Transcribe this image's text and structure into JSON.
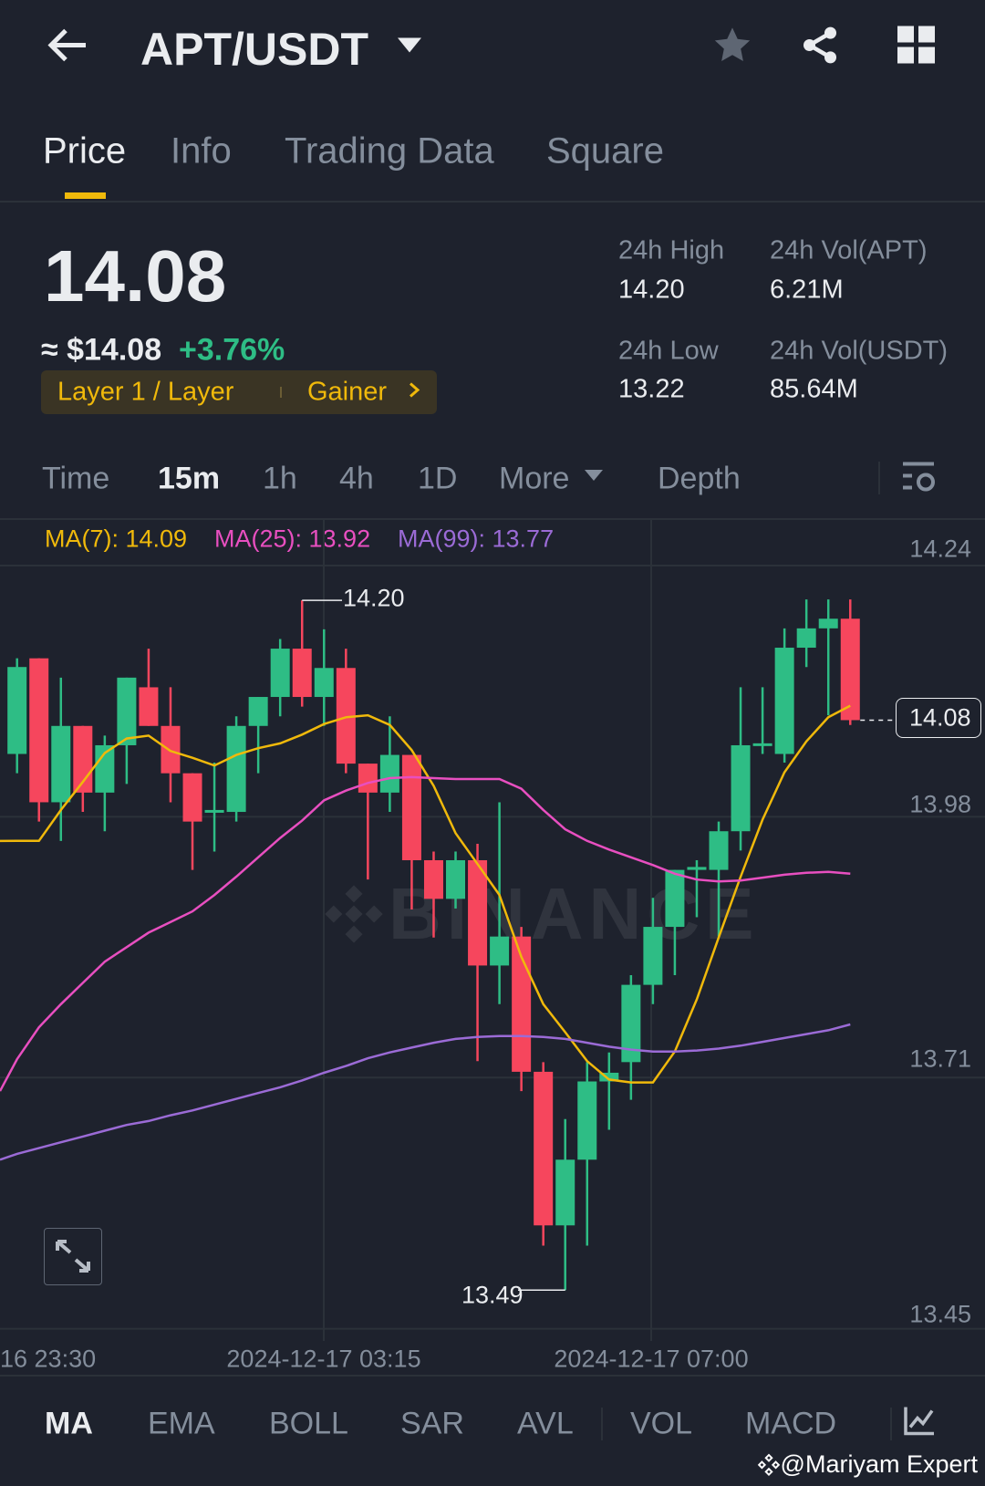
{
  "header": {
    "title": "APT/USDT",
    "icons": [
      "back-arrow-icon",
      "caret-down-icon",
      "star-icon",
      "share-icon",
      "grid-icon"
    ]
  },
  "tabs": [
    {
      "label": "Price",
      "active": true
    },
    {
      "label": "Info"
    },
    {
      "label": "Trading Data"
    },
    {
      "label": "Square"
    }
  ],
  "ticker": {
    "last_price": "14.08",
    "fiat_price": "≈ $14.08",
    "change": "+3.76%",
    "tag_category": "Layer 1 / Layer",
    "tag_rank": "Gainer",
    "stats": [
      {
        "label": "24h High",
        "value": "14.20"
      },
      {
        "label": "24h Vol(APT)",
        "value": "6.21M"
      },
      {
        "label": "24h Low",
        "value": "13.22"
      },
      {
        "label": "24h Vol(USDT)",
        "value": "85.64M"
      }
    ]
  },
  "intervals": {
    "items": [
      "Time",
      "15m",
      "1h",
      "4h",
      "1D",
      "More",
      "Depth"
    ],
    "active": "15m"
  },
  "ma_legend": [
    {
      "label": "MA(7): 14.09",
      "color": "#f0b90b"
    },
    {
      "label": "MA(25): 13.92",
      "color": "#e84fc0"
    },
    {
      "label": "MA(99): 13.77",
      "color": "#9b6bd6"
    }
  ],
  "indicators": {
    "items": [
      "MA",
      "EMA",
      "BOLL",
      "SAR",
      "AVL",
      "VOL",
      "MACD"
    ],
    "active": "MA"
  },
  "watermark": "@Mariyam Expert",
  "colors": {
    "up": "#2ebd85",
    "down": "#f6465d",
    "accent": "#f0b90b",
    "bg": "#1e222d"
  },
  "chart_data": {
    "type": "candlestick",
    "price_axis": [
      "14.24",
      "13.98",
      "13.71",
      "13.45"
    ],
    "ylim": [
      13.45,
      14.24
    ],
    "time_labels": [
      "16 23:30",
      "2024-12-17 03:15",
      "2024-12-17 07:00"
    ],
    "high_marker": "14.20",
    "low_marker": "13.49",
    "current_price": "14.08",
    "candles": [
      [
        14.045,
        14.135,
        14.144,
        14.025
      ],
      [
        14.144,
        13.995,
        14.144,
        13.975
      ],
      [
        13.995,
        14.074,
        14.124,
        13.955
      ],
      [
        14.074,
        14.005,
        14.074,
        13.985
      ],
      [
        14.005,
        14.054,
        14.064,
        13.965
      ],
      [
        14.054,
        14.124,
        14.124,
        14.014
      ],
      [
        14.114,
        14.074,
        14.154,
        14.074
      ],
      [
        14.074,
        14.025,
        14.114,
        13.995
      ],
      [
        14.025,
        13.975,
        14.025,
        13.925
      ],
      [
        13.985,
        13.987,
        14.036,
        13.944
      ],
      [
        13.985,
        14.074,
        14.084,
        13.975
      ],
      [
        14.074,
        14.104,
        14.104,
        14.025
      ],
      [
        14.104,
        14.154,
        14.164,
        14.084
      ],
      [
        14.154,
        14.104,
        14.204,
        14.094
      ],
      [
        14.104,
        14.134,
        14.174,
        14.074
      ],
      [
        14.134,
        14.035,
        14.154,
        14.025
      ],
      [
        14.035,
        14.005,
        14.035,
        13.915
      ],
      [
        14.005,
        14.044,
        14.084,
        13.985
      ],
      [
        14.044,
        13.935,
        14.044,
        13.884
      ],
      [
        13.935,
        13.895,
        13.944,
        13.855
      ],
      [
        13.895,
        13.935,
        13.944,
        13.885
      ],
      [
        13.935,
        13.826,
        13.952,
        13.727
      ],
      [
        13.826,
        13.856,
        13.995,
        13.786
      ],
      [
        13.856,
        13.716,
        13.866,
        13.696
      ],
      [
        13.716,
        13.557,
        13.726,
        13.536
      ],
      [
        13.557,
        13.625,
        13.667,
        13.49
      ],
      [
        13.625,
        13.706,
        13.726,
        13.536
      ],
      [
        13.706,
        13.715,
        13.736,
        13.656
      ],
      [
        13.726,
        13.806,
        13.816,
        13.687
      ],
      [
        13.806,
        13.866,
        13.896,
        13.786
      ],
      [
        13.866,
        13.925,
        13.925,
        13.816
      ],
      [
        13.925,
        13.928,
        13.935,
        13.876
      ],
      [
        13.925,
        13.965,
        13.975,
        13.856
      ],
      [
        13.965,
        14.054,
        14.114,
        13.945
      ],
      [
        14.054,
        14.056,
        14.114,
        14.045
      ],
      [
        14.045,
        14.155,
        14.175,
        14.036
      ],
      [
        14.155,
        14.175,
        14.205,
        14.135
      ],
      [
        14.175,
        14.185,
        14.205,
        14.085
      ],
      [
        14.185,
        14.08,
        14.205,
        14.075
      ]
    ],
    "ma7": [
      13.955,
      13.955,
      13.987,
      14.016,
      14.046,
      14.061,
      14.064,
      14.048,
      14.041,
      14.033,
      14.044,
      14.051,
      14.056,
      14.065,
      14.076,
      14.083,
      14.085,
      14.075,
      14.049,
      14.012,
      13.963,
      13.931,
      13.899,
      13.835,
      13.786,
      13.757,
      13.727,
      13.708,
      13.705,
      13.705,
      13.737,
      13.791,
      13.855,
      13.918,
      13.977,
      14.026,
      14.058,
      14.083,
      14.095
    ],
    "ma25": [
      13.729,
      13.762,
      13.786,
      13.808,
      13.83,
      13.845,
      13.86,
      13.871,
      13.882,
      13.899,
      13.918,
      13.938,
      13.958,
      13.976,
      13.997,
      14.007,
      14.015,
      14.02,
      14.021,
      14.02,
      14.019,
      14.019,
      14.019,
      14.009,
      13.987,
      13.967,
      13.955,
      13.946,
      13.938,
      13.93,
      13.921,
      13.915,
      13.913,
      13.914,
      13.917,
      13.92,
      13.922,
      13.923,
      13.921
    ],
    "ma99": [
      13.631,
      13.637,
      13.643,
      13.649,
      13.655,
      13.661,
      13.665,
      13.671,
      13.676,
      13.682,
      13.688,
      13.694,
      13.7,
      13.707,
      13.715,
      13.722,
      13.73,
      13.736,
      13.741,
      13.746,
      13.75,
      13.752,
      13.753,
      13.753,
      13.752,
      13.75,
      13.746,
      13.742,
      13.739,
      13.737,
      13.737,
      13.738,
      13.74,
      13.743,
      13.747,
      13.751,
      13.755,
      13.759,
      13.765
    ]
  }
}
